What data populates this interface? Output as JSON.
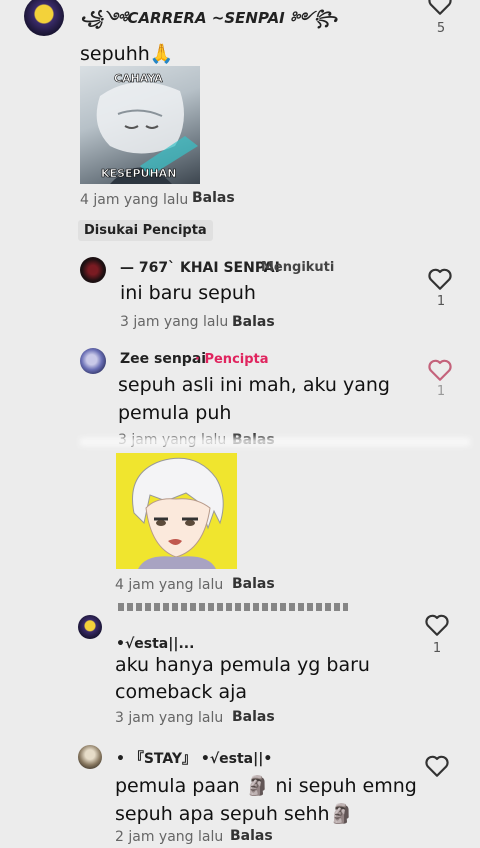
{
  "comments": [
    {
      "username": "꧁༺CARRERA ~SENPAI ༻꧂",
      "text": "sepuhh🙏",
      "sticker": {
        "top_text": "CAHAYA",
        "bottom_text": "KESEPUHAN"
      },
      "time": "4 jam yang lalu",
      "reply_label": "Balas",
      "likes": "5",
      "badge": "Disukai Pencipta"
    },
    {
      "username": "— 767` KHAI SENPAI",
      "follow_label": "Mengikuti",
      "text": "ini baru sepuh",
      "time": "3 jam yang lalu",
      "reply_label": "Balas",
      "likes": "1"
    },
    {
      "username": "Zee senpai",
      "creator_label": "· Pencipta",
      "text_lines": [
        "sepuh asli ini mah, aku yang",
        "pemula puh"
      ],
      "time": "3 jam yang lalu",
      "reply_label": "Balas",
      "likes": "1"
    },
    {
      "time": "4 jam yang lalu",
      "reply_label": "Balas"
    },
    {
      "username": "•√esta||...",
      "text_lines": [
        "aku hanya pemula yg baru",
        "comeback aja"
      ],
      "time": "3 jam yang lalu",
      "reply_label": "Balas",
      "likes": "1"
    },
    {
      "username": "• 『STAY』 •√esta||•",
      "text_lines": [
        "pemula paan 🗿 ni sepuh emng",
        "sepuh apa sepuh sehh🗿"
      ],
      "time": "2 jam yang lalu",
      "reply_label": "Balas"
    }
  ],
  "colors": {
    "creator": "#e0245e",
    "background": "#ececec"
  }
}
